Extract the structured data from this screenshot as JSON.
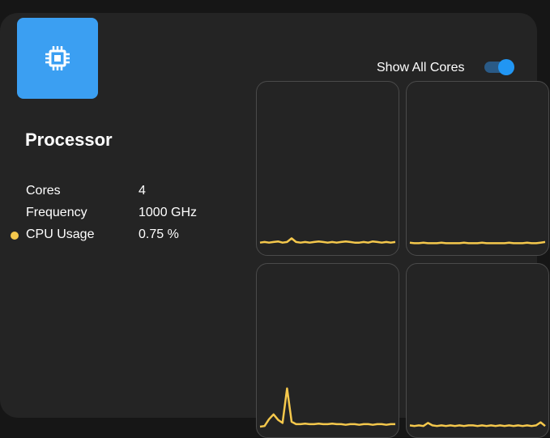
{
  "colors": {
    "accent": "#3b9ff2",
    "line": "#f5c84c",
    "card": "#242424",
    "toggle_on": "#2196f3"
  },
  "processor": {
    "icon": "cpu-chip-icon",
    "title": "Processor",
    "stats": [
      {
        "label": "Cores",
        "value": "4"
      },
      {
        "label": "Frequency",
        "value": "1000 GHz"
      },
      {
        "label": "CPU Usage",
        "value": "0.75 %"
      }
    ]
  },
  "toggle": {
    "label": "Show All Cores",
    "on": true
  },
  "cores": [
    {
      "usage": [
        0.7,
        0.8,
        0.7,
        0.8,
        0.9,
        0.7,
        0.8,
        1.4,
        0.8,
        0.7,
        0.8,
        0.7,
        0.8,
        0.9,
        0.8,
        0.7,
        0.8,
        0.7,
        0.8,
        0.9,
        0.8,
        0.7,
        0.7,
        0.8,
        0.7,
        0.9,
        0.8,
        0.7,
        0.8,
        0.7,
        0.8
      ]
    },
    {
      "usage": [
        0.7,
        0.6,
        0.6,
        0.7,
        0.6,
        0.6,
        0.6,
        0.7,
        0.6,
        0.6,
        0.6,
        0.6,
        0.7,
        0.6,
        0.6,
        0.6,
        0.7,
        0.6,
        0.6,
        0.6,
        0.6,
        0.6,
        0.7,
        0.6,
        0.6,
        0.6,
        0.7,
        0.6,
        0.6,
        0.7,
        0.8
      ]
    },
    {
      "usage": [
        0.4,
        0.5,
        1.6,
        2.4,
        1.5,
        1.0,
        6.6,
        1.2,
        0.8,
        0.8,
        0.9,
        0.8,
        0.8,
        0.9,
        0.8,
        0.8,
        0.9,
        0.8,
        0.8,
        0.7,
        0.8,
        0.8,
        0.7,
        0.8,
        0.8,
        0.7,
        0.8,
        0.8,
        0.7,
        0.8,
        0.8
      ]
    },
    {
      "usage": [
        0.6,
        0.5,
        0.6,
        0.5,
        1.0,
        0.6,
        0.5,
        0.6,
        0.5,
        0.6,
        0.5,
        0.6,
        0.5,
        0.6,
        0.6,
        0.5,
        0.6,
        0.5,
        0.6,
        0.5,
        0.6,
        0.5,
        0.6,
        0.5,
        0.6,
        0.5,
        0.6,
        0.5,
        0.6,
        1.1,
        0.5
      ]
    }
  ],
  "graph_max": 25
}
